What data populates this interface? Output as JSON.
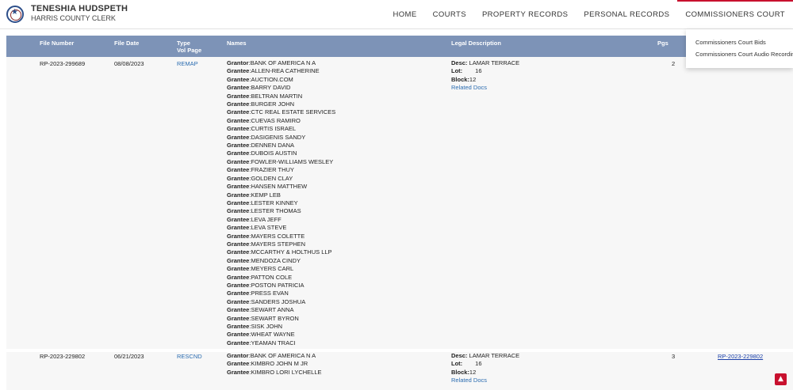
{
  "brand": {
    "name": "TENESHIA HUDSPETH",
    "subtitle": "HARRIS COUNTY CLERK",
    "logo_icon": "county-seal-icon"
  },
  "nav": {
    "items": [
      "HOME",
      "COURTS",
      "PROPERTY RECORDS",
      "PERSONAL RECORDS",
      "COMMISSIONERS COURT"
    ],
    "active": "COMMISSIONERS COURT",
    "active_color": "#c8102e"
  },
  "dropdown": {
    "items": [
      "Commissioners Court Bids",
      "Commissioners Court Audio Recordings"
    ]
  },
  "table": {
    "header_color": "#7d93b7",
    "columns": {
      "file_number": "File Number",
      "file_date": "File Date",
      "type": "Type",
      "vol_page": "Vol Page",
      "names": "Names",
      "legal": "Legal Description",
      "pgs": "Pgs"
    },
    "rows": [
      {
        "file_number": "RP-2023-299689",
        "file_date": "08/08/2023",
        "type": "REMAP",
        "names": [
          {
            "role": "Grantor",
            "name": "BANK OF AMERICA N A"
          },
          {
            "role": "Grantee",
            "name": "ALLEN-REA CATHERINE"
          },
          {
            "role": "Grantee",
            "name": "AUCTION.COM"
          },
          {
            "role": "Grantee",
            "name": "BARRY DAVID"
          },
          {
            "role": "Grantee",
            "name": "BELTRAN MARTIN"
          },
          {
            "role": "Grantee",
            "name": "BURGER JOHN"
          },
          {
            "role": "Grantee",
            "name": "CTC REAL ESTATE SERVICES"
          },
          {
            "role": "Grantee",
            "name": "CUEVAS RAMIRO"
          },
          {
            "role": "Grantee",
            "name": "CURTIS ISRAEL"
          },
          {
            "role": "Grantee",
            "name": "DASIGENIS SANDY"
          },
          {
            "role": "Grantee",
            "name": "DENNEN DANA"
          },
          {
            "role": "Grantee",
            "name": "DUBOIS AUSTIN"
          },
          {
            "role": "Grantee",
            "name": "FOWLER-WILLIAMS WESLEY"
          },
          {
            "role": "Grantee",
            "name": "FRAZIER THUY"
          },
          {
            "role": "Grantee",
            "name": "GOLDEN CLAY"
          },
          {
            "role": "Grantee",
            "name": "HANSEN MATTHEW"
          },
          {
            "role": "Grantee",
            "name": "KEMP LEB"
          },
          {
            "role": "Grantee",
            "name": "LESTER KINNEY"
          },
          {
            "role": "Grantee",
            "name": "LESTER THOMAS"
          },
          {
            "role": "Grantee",
            "name": "LEVA JEFF"
          },
          {
            "role": "Grantee",
            "name": "LEVA STEVE"
          },
          {
            "role": "Grantee",
            "name": "MAYERS COLETTE"
          },
          {
            "role": "Grantee",
            "name": "MAYERS STEPHEN"
          },
          {
            "role": "Grantee",
            "name": "MCCARTHY & HOLTHUS LLP"
          },
          {
            "role": "Grantee",
            "name": "MENDOZA CINDY"
          },
          {
            "role": "Grantee",
            "name": "MEYERS CARL"
          },
          {
            "role": "Grantee",
            "name": "PATTON COLE"
          },
          {
            "role": "Grantee",
            "name": "POSTON PATRICIA"
          },
          {
            "role": "Grantee",
            "name": "PRESS EVAN"
          },
          {
            "role": "Grantee",
            "name": "SANDERS JOSHUA"
          },
          {
            "role": "Grantee",
            "name": "SEWART ANNA"
          },
          {
            "role": "Grantee",
            "name": "SEWART BYRON"
          },
          {
            "role": "Grantee",
            "name": "SISK JOHN"
          },
          {
            "role": "Grantee",
            "name": "WHEAT WAYNE"
          },
          {
            "role": "Grantee",
            "name": "YEAMAN TRACI"
          }
        ],
        "legal": {
          "desc_label": "Desc:",
          "desc": "LAMAR TERRACE",
          "lot_label": "Lot:",
          "lot": "16",
          "block_label": "Block:",
          "block": "12",
          "related": "Related Docs"
        },
        "pgs": "2",
        "ref": ""
      },
      {
        "file_number": "RP-2023-229802",
        "file_date": "06/21/2023",
        "type": "RESCND",
        "names": [
          {
            "role": "Grantor",
            "name": "BANK OF AMERICA N A"
          },
          {
            "role": "Grantee",
            "name": "KIMBRO JOHN M JR"
          },
          {
            "role": "Grantee",
            "name": "KIMBRO LORI LYCHELLE"
          }
        ],
        "legal": {
          "desc_label": "Desc:",
          "desc": "LAMAR TERRACE",
          "lot_label": "Lot:",
          "lot": "16",
          "block_label": "Block:",
          "block": "12",
          "related": "Related Docs"
        },
        "pgs": "3",
        "ref": "RP-2023-229802"
      }
    ]
  },
  "scroll_top_icon": "chevron-up-icon"
}
